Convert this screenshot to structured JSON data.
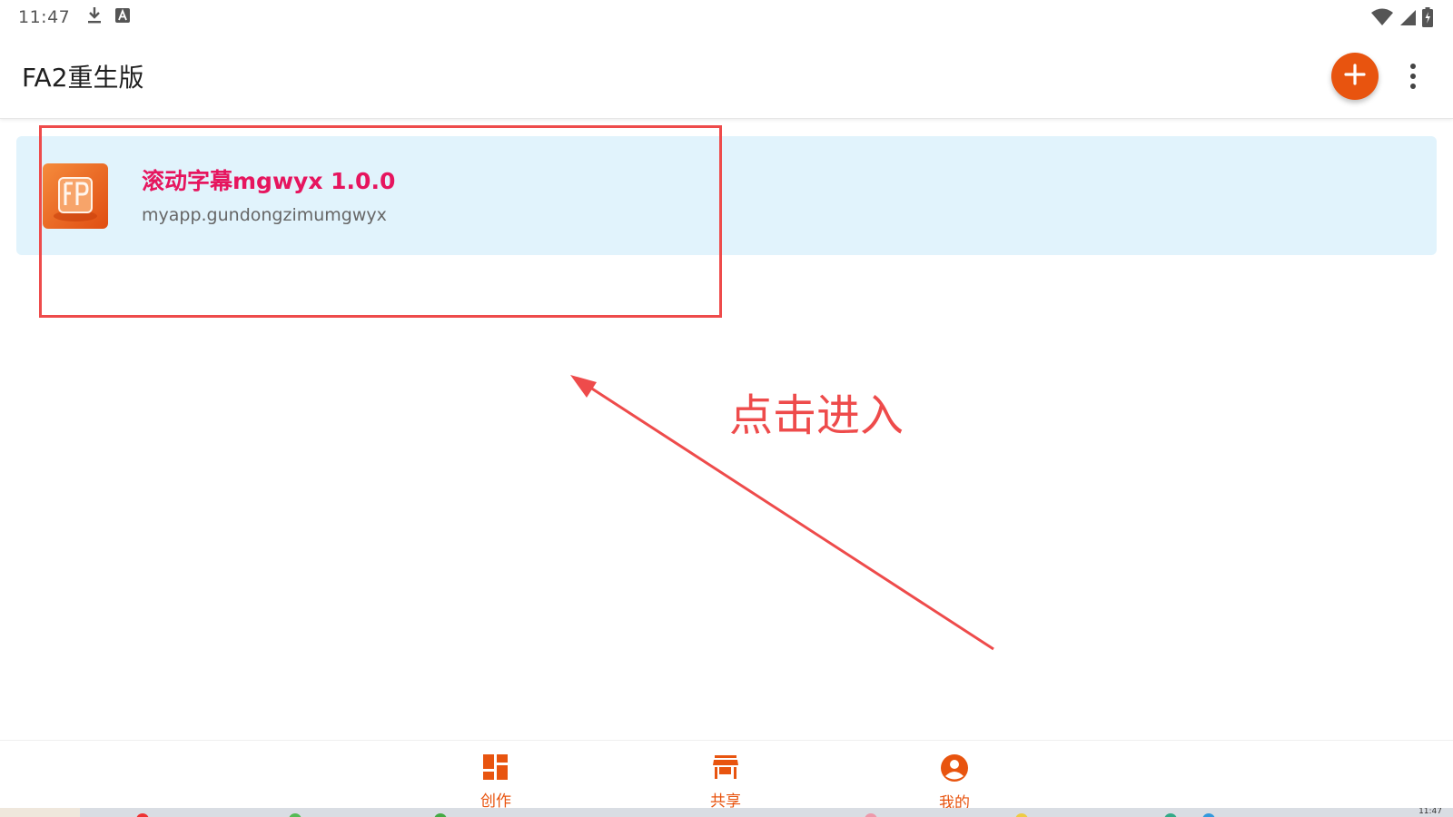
{
  "status_bar": {
    "time": "11:47",
    "icons": [
      "download-icon",
      "keyboard-a-icon",
      "wifi-icon",
      "cell-signal-icon",
      "battery-charging-icon"
    ]
  },
  "app_bar": {
    "title": "FA2重生版",
    "add_icon": "plus-icon",
    "menu_icon": "more-vert-icon"
  },
  "project": {
    "name": "滚动字幕mgwyx 1.0.0",
    "package": "myapp.gundongzimumgwyx",
    "icon": "fap-app-icon",
    "name_color": "#e6155e",
    "card_color": "#e1f3fc"
  },
  "annotation": {
    "label": "点击进入",
    "color": "#ee4b4b"
  },
  "bottom_nav": {
    "items": [
      {
        "label": "创作",
        "icon": "dashboard-icon"
      },
      {
        "label": "共享",
        "icon": "store-icon"
      },
      {
        "label": "我的",
        "icon": "account-circle-icon"
      }
    ],
    "accent": "#e8540f"
  },
  "taskbar": {
    "clock": "11:47"
  }
}
